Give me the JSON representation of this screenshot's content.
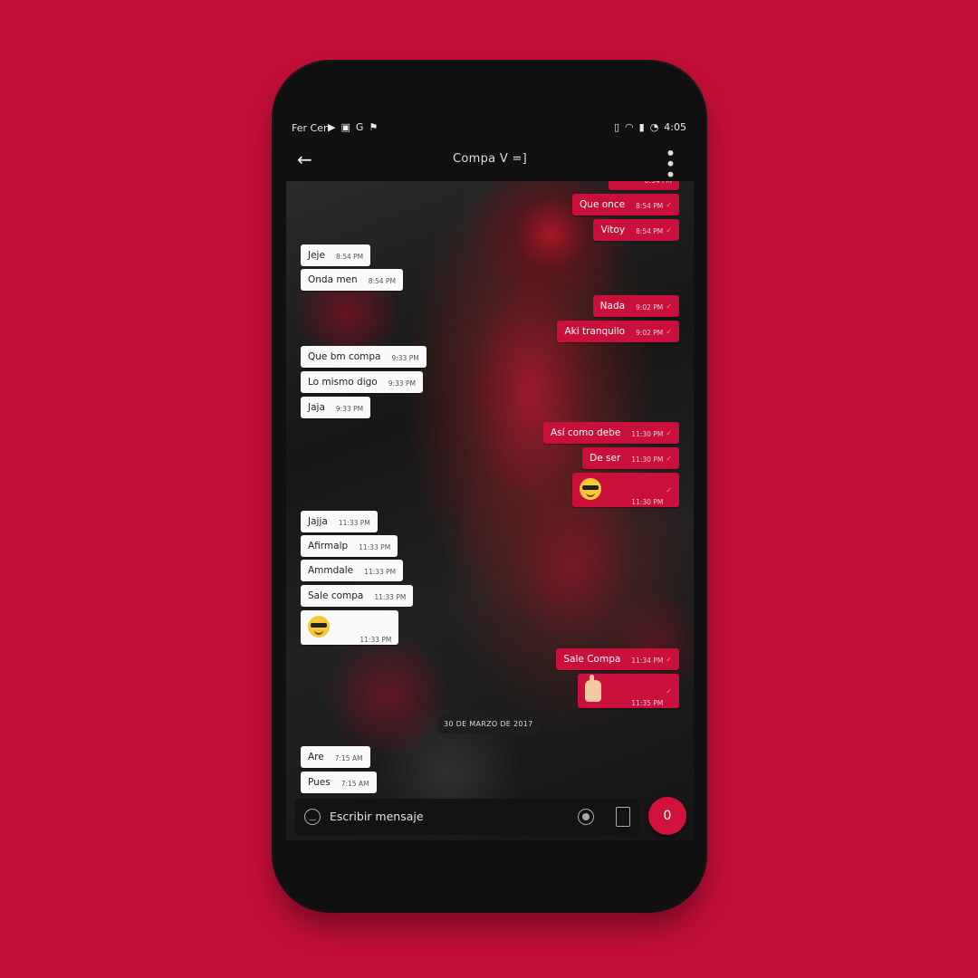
{
  "status_bar": {
    "carrier": "Fer Cen",
    "time": "4:05",
    "left_icons": [
      "youtube-icon",
      "image-icon",
      "google-plus-icon",
      "notification-icon"
    ],
    "right_icons": [
      "vibrate-icon",
      "wifi-icon",
      "signal-icon",
      "battery-icon"
    ]
  },
  "app_bar": {
    "back_icon": "←",
    "title": "Compa V =]",
    "menu_icon": "⋮"
  },
  "messages": [
    {
      "dir": "out",
      "text": "Que once",
      "time": "8:54 PM"
    },
    {
      "dir": "out",
      "text": "Vitoy",
      "time": "8:54 PM"
    },
    {
      "dir": "in",
      "text": "Jeje",
      "time": "8:54 PM"
    },
    {
      "dir": "in",
      "text": "Onda men",
      "time": "8:54 PM"
    },
    {
      "dir": "out",
      "text": "Nada",
      "time": "9:02 PM"
    },
    {
      "dir": "out",
      "text": "Aki tranquilo",
      "time": "9:02 PM"
    },
    {
      "dir": "in",
      "text": "Que bm compa",
      "time": "9:33 PM"
    },
    {
      "dir": "in",
      "text": "Lo mismo digo",
      "time": "9:33 PM"
    },
    {
      "dir": "in",
      "text": "Jaja",
      "time": "9:33 PM"
    },
    {
      "dir": "out",
      "text": "Así como debe",
      "time": "11:30 PM"
    },
    {
      "dir": "out",
      "text": "De ser",
      "time": "11:30 PM"
    },
    {
      "dir": "out",
      "text": "",
      "emoji": "sunglasses-emoji",
      "time": "11:30 PM"
    },
    {
      "dir": "in",
      "text": "Jajja",
      "time": "11:33 PM"
    },
    {
      "dir": "in",
      "text": "Afirmalp",
      "time": "11:33 PM"
    },
    {
      "dir": "in",
      "text": "Ammdale",
      "time": "11:33 PM"
    },
    {
      "dir": "in",
      "text": "Sale compa",
      "time": "11:33 PM"
    },
    {
      "dir": "in",
      "text": "",
      "emoji": "sunglasses-emoji",
      "time": "11:33 PM"
    },
    {
      "dir": "out",
      "text": "Sale Compa",
      "time": "11:34 PM"
    },
    {
      "dir": "out",
      "text": "",
      "emoji": "crossed-fingers-emoji",
      "time": "11:35 PM"
    },
    {
      "dir": "in",
      "text": "Are",
      "time": "7:15 AM"
    },
    {
      "dir": "in",
      "text": "Pues",
      "time": "7:15 AM"
    }
  ],
  "date_divider": "30 DE MARZO DE 2017",
  "composer": {
    "placeholder": "Escribir mensaje",
    "fab_label": "0"
  },
  "colors": {
    "background": "#c20f36",
    "outgoing_bubble": "#c8103a",
    "incoming_bubble": "#fafafa",
    "bar": "#111111",
    "fab": "#d0123d"
  }
}
